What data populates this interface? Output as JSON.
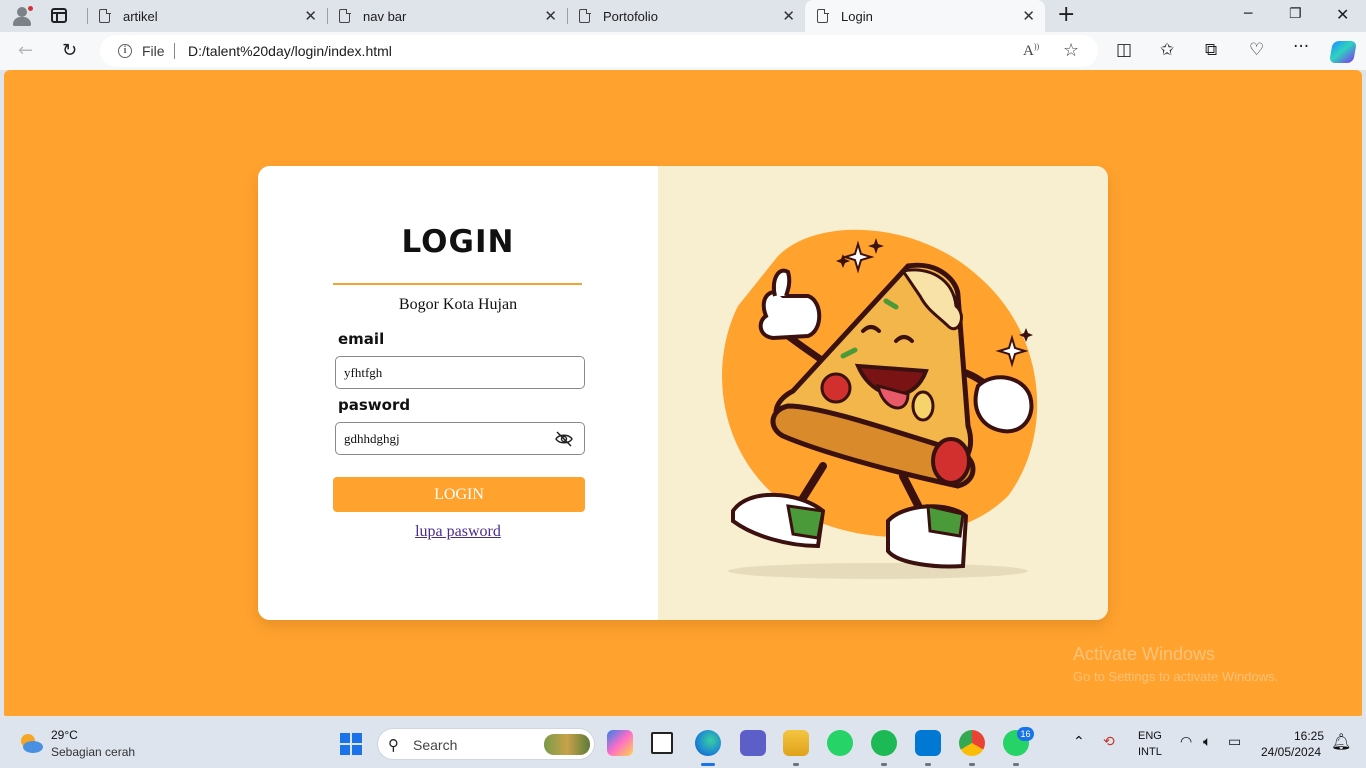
{
  "browser": {
    "tabs": [
      {
        "title": "artikel",
        "active": false
      },
      {
        "title": "nav bar",
        "active": false
      },
      {
        "title": "Portofolio",
        "active": false
      },
      {
        "title": "Login",
        "active": true
      }
    ],
    "address": {
      "scheme_label": "File",
      "url": "D:/talent%20day/login/index.html"
    },
    "icons": [
      "profile-icon",
      "tab-actions-icon",
      "back-icon",
      "refresh-icon",
      "info-icon",
      "read-aloud-icon",
      "favorite-star-icon",
      "split-screen-icon",
      "favorites-icon",
      "collections-icon",
      "browser-essentials-icon",
      "more-icon",
      "copilot-icon"
    ]
  },
  "page": {
    "background_color": "#ffa22e",
    "login": {
      "title": "LOGIN",
      "subtitle": "Bogor Kota Hujan",
      "email_label": "email",
      "email_value": "yfhtfgh",
      "password_label": "pasword",
      "password_value": "gdhhdghgj",
      "submit_label": "LOGIN",
      "forgot_link": "lupa pasword",
      "accent_color": "#f5a133"
    },
    "illustration": {
      "subject": "dancing pizza slice mascot",
      "panel_color": "#f7efcf"
    }
  },
  "watermark": {
    "line1": "Activate Windows",
    "line2": "Go to Settings to activate Windows."
  },
  "taskbar": {
    "weather_temp": "29°C",
    "weather_desc": "Sebagian cerah",
    "search_placeholder": "Search",
    "apps": [
      "copilot-pre",
      "task-view",
      "edge",
      "teams",
      "file-explorer",
      "whatsapp",
      "spotify",
      "vscode",
      "chrome",
      "whatsapp-beta"
    ],
    "notification_badge": "16",
    "language_line1": "ENG",
    "language_line2": "INTL",
    "time": "16:25",
    "date": "24/05/2024"
  }
}
